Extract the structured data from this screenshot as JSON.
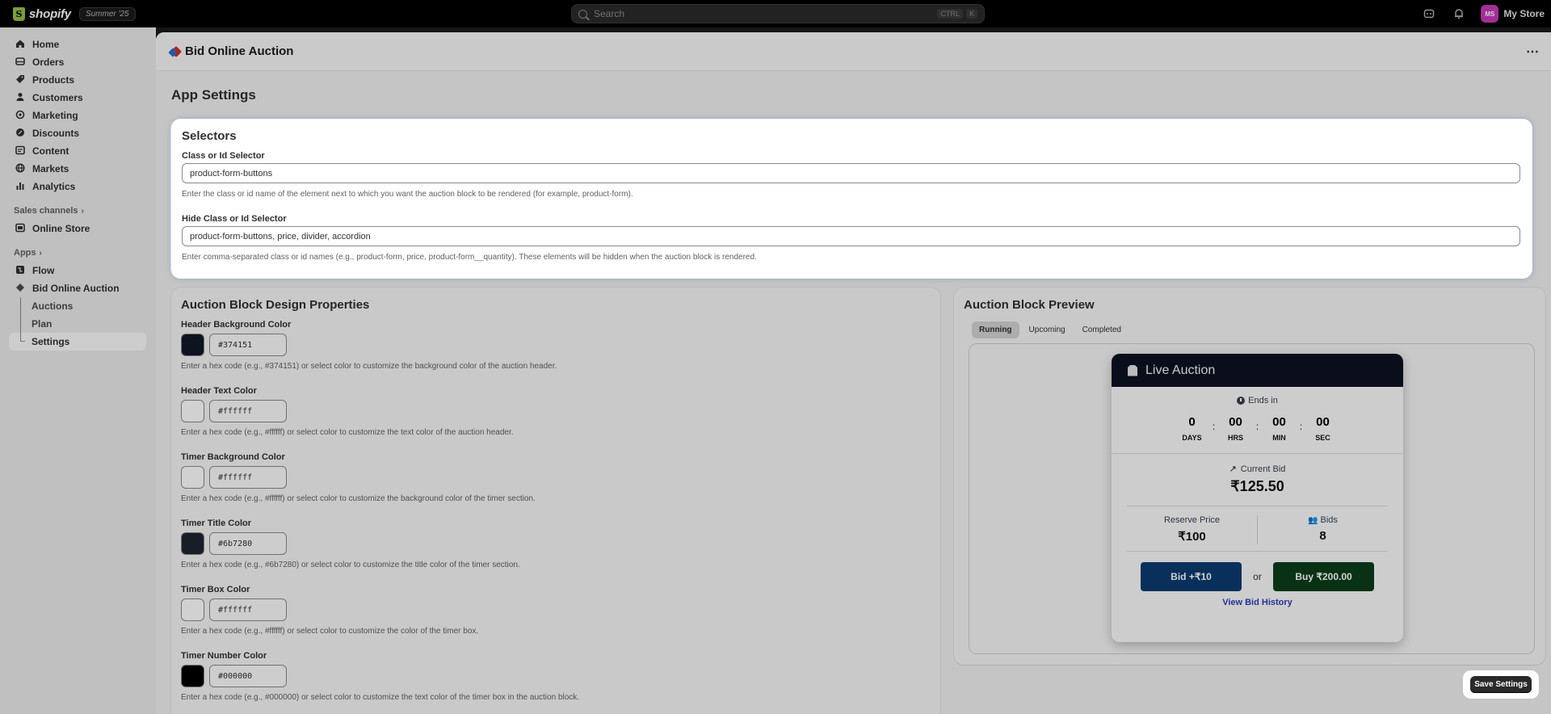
{
  "topbar": {
    "brand": "shopify",
    "brand_glyph": "S",
    "edition": "Summer '25",
    "search_placeholder": "Search",
    "shortcut_1": "CTRL",
    "shortcut_2": "K",
    "avatar_initials": "MS",
    "store_name": "My Store"
  },
  "sidebar": {
    "items": [
      {
        "label": "Home",
        "icon": "home-icon"
      },
      {
        "label": "Orders",
        "icon": "orders-icon"
      },
      {
        "label": "Products",
        "icon": "tag-icon"
      },
      {
        "label": "Customers",
        "icon": "person-icon"
      },
      {
        "label": "Marketing",
        "icon": "target-icon"
      },
      {
        "label": "Discounts",
        "icon": "discount-icon"
      },
      {
        "label": "Content",
        "icon": "content-icon"
      },
      {
        "label": "Markets",
        "icon": "globe-icon"
      },
      {
        "label": "Analytics",
        "icon": "bar-chart-icon"
      }
    ],
    "sales_channels_label": "Sales channels",
    "online_store": "Online Store",
    "apps_label": "Apps",
    "flow": "Flow",
    "bid_app": "Bid Online Auction",
    "sub_items": [
      "Auctions",
      "Plan",
      "Settings"
    ]
  },
  "app_header": {
    "title": "Bid Online Auction",
    "more": "⋯"
  },
  "page_title": "App Settings",
  "selectors": {
    "title": "Selectors",
    "class_label": "Class or Id Selector",
    "class_value": "product-form-buttons",
    "class_help": "Enter the class or id name of the element next to which you want the auction block to be rendered (for example, product-form).",
    "hide_label": "Hide Class or Id Selector",
    "hide_value": "product-form-buttons, price, divider, accordion",
    "hide_help": "Enter comma-separated class or id names (e.g., product-form, price, product-form__quantity). These elements will be hidden when the auction block is rendered."
  },
  "design": {
    "title": "Auction Block Design Properties",
    "fields": [
      {
        "label": "Header Background Color",
        "value": "#374151",
        "swatch": "#111827",
        "help": "Enter a hex code (e.g., #374151) or select color to customize the background color of the auction header."
      },
      {
        "label": "Header Text Color",
        "value": "#ffffff",
        "swatch": "#ffffff",
        "help": "Enter a hex code (e.g., #ffffff) or select color to customize the text color of the auction header."
      },
      {
        "label": "Timer Background Color",
        "value": "#ffffff",
        "swatch": "#ffffff",
        "help": "Enter a hex code (e.g., #ffffff) or select color to customize the background color of the timer section."
      },
      {
        "label": "Timer Title Color",
        "value": "#6b7280",
        "swatch": "#1f2430",
        "help": "Enter a hex code (e.g., #6b7280) or select color to customize the title color of the timer section."
      },
      {
        "label": "Timer Box Color",
        "value": "#ffffff",
        "swatch": "#ffffff",
        "help": "Enter a hex code (e.g., #ffffff) or select color to customize the color of the timer box."
      },
      {
        "label": "Timer Number Color",
        "value": "#000000",
        "swatch": "#000000",
        "help": "Enter a hex code (e.g., #000000) or select color to customize the text color of the timer box in the auction block."
      }
    ]
  },
  "preview": {
    "title": "Auction Block Preview",
    "tabs": [
      "Running",
      "Upcoming",
      "Completed"
    ],
    "header": "Live Auction",
    "ends_in": "Ends in",
    "timer": [
      {
        "num": "0",
        "unit": "DAYS"
      },
      {
        "num": "00",
        "unit": "HRS"
      },
      {
        "num": "00",
        "unit": "MIN"
      },
      {
        "num": "00",
        "unit": "SEC"
      }
    ],
    "sep": ":",
    "current_bid_label": "Current Bid",
    "current_bid": "₹125.50",
    "reserve_label": "Reserve Price",
    "reserve": "₹100",
    "bids_label": "Bids",
    "bids": "8",
    "bid_button": "Bid +₹10",
    "or": "or",
    "buy_button": "Buy ₹200.00",
    "history": "View Bid History"
  },
  "save_button": "Save Settings"
}
